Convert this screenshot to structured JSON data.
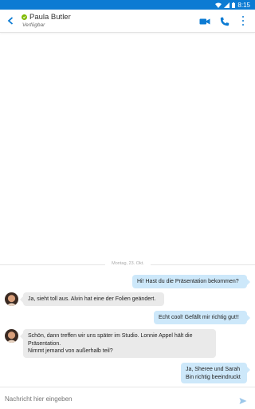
{
  "status_bar": {
    "time": "8:15"
  },
  "header": {
    "contact_name": "Paula Butler",
    "contact_status": "Verfügbar"
  },
  "conversation": {
    "date_divider": "Montag, 23. Okt.",
    "messages": [
      {
        "direction": "outgoing",
        "lines": [
          "Hi! Hast du die Präsentation bekommen?"
        ]
      },
      {
        "direction": "incoming",
        "lines": [
          "Ja, sieht toll aus. Alvin hat eine der Folien geändert."
        ]
      },
      {
        "direction": "outgoing",
        "lines": [
          "Echt cool! Gefällt mir richtig gut!!"
        ]
      },
      {
        "direction": "incoming",
        "lines": [
          "Schön, dann treffen wir uns später im Studio. Lonnie Appel hält die",
          "Präsentation.",
          "Nimmt jemand von außerhalb teil?"
        ]
      },
      {
        "direction": "outgoing",
        "lines": [
          "Ja, Sheree und Sarah",
          "Bin richtig beeindruckt"
        ]
      }
    ]
  },
  "composer": {
    "placeholder": "Nachricht hier eingeben"
  },
  "colors": {
    "accent": "#0c7bd3",
    "presence": "#7fba00",
    "outgoing_bubble": "#cde8fa",
    "incoming_bubble": "#eaeaea"
  }
}
